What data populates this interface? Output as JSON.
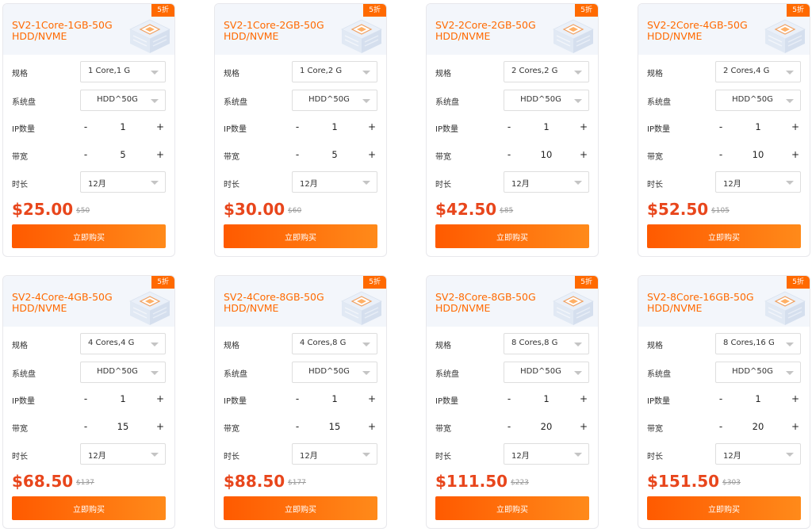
{
  "labels": {
    "spec": "规格",
    "disk": "系统盘",
    "ip": "IP数量",
    "bandwidth": "带宽",
    "duration": "时长",
    "buy": "立即购买",
    "minus": "-",
    "plus": "+"
  },
  "colors": {
    "accent": "#ff6a00",
    "price": "#e8461c"
  },
  "plans": [
    {
      "title": "SV2-1Core-1GB-50G HDD/NVME",
      "discount": "5折",
      "spec": "1 Core,1 G",
      "disk": "HDD^50G",
      "ip": "1",
      "bandwidth": "5",
      "duration": "12月",
      "price": "$25.00",
      "old_price": "$50"
    },
    {
      "title": "SV2-1Core-2GB-50G HDD/NVME",
      "discount": "5折",
      "spec": "1 Core,2 G",
      "disk": "HDD^50G",
      "ip": "1",
      "bandwidth": "5",
      "duration": "12月",
      "price": "$30.00",
      "old_price": "$60"
    },
    {
      "title": "SV2-2Core-2GB-50G HDD/NVME",
      "discount": "5折",
      "spec": "2 Cores,2 G",
      "disk": "HDD^50G",
      "ip": "1",
      "bandwidth": "10",
      "duration": "12月",
      "price": "$42.50",
      "old_price": "$85"
    },
    {
      "title": "SV2-2Core-4GB-50G HDD/NVME",
      "discount": "5折",
      "spec": "2 Cores,4 G",
      "disk": "HDD^50G",
      "ip": "1",
      "bandwidth": "10",
      "duration": "12月",
      "price": "$52.50",
      "old_price": "$105"
    },
    {
      "title": "SV2-4Core-4GB-50G HDD/NVME",
      "discount": "5折",
      "spec": "4 Cores,4 G",
      "disk": "HDD^50G",
      "ip": "1",
      "bandwidth": "15",
      "duration": "12月",
      "price": "$68.50",
      "old_price": "$137"
    },
    {
      "title": "SV2-4Core-8GB-50G HDD/NVME",
      "discount": "5折",
      "spec": "4 Cores,8 G",
      "disk": "HDD^50G",
      "ip": "1",
      "bandwidth": "15",
      "duration": "12月",
      "price": "$88.50",
      "old_price": "$177"
    },
    {
      "title": "SV2-8Core-8GB-50G HDD/NVME",
      "discount": "5折",
      "spec": "8 Cores,8 G",
      "disk": "HDD^50G",
      "ip": "1",
      "bandwidth": "20",
      "duration": "12月",
      "price": "$111.50",
      "old_price": "$223"
    },
    {
      "title": "SV2-8Core-16GB-50G HDD/NVME",
      "discount": "5折",
      "spec": "8 Cores,16 G",
      "disk": "HDD^50G",
      "ip": "1",
      "bandwidth": "20",
      "duration": "12月",
      "price": "$151.50",
      "old_price": "$303"
    }
  ]
}
